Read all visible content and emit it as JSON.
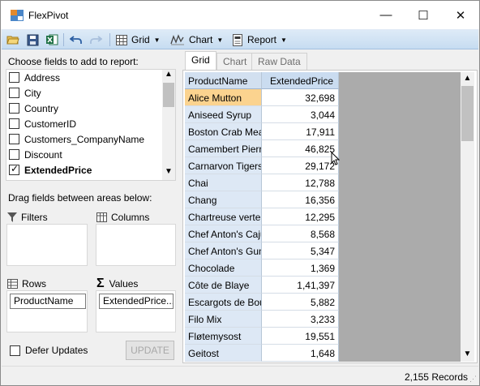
{
  "window": {
    "title": "FlexPivot",
    "minimize": "—",
    "maximize": "☐",
    "close": "✕"
  },
  "toolbar": {
    "grid_label": "Grid",
    "chart_label": "Chart",
    "report_label": "Report",
    "accent": "#c6dcf1"
  },
  "fields": {
    "caption": "Choose fields to add to report:",
    "items": [
      {
        "label": "Address",
        "checked": false
      },
      {
        "label": "City",
        "checked": false
      },
      {
        "label": "Country",
        "checked": false
      },
      {
        "label": "CustomerID",
        "checked": false
      },
      {
        "label": "Customers_CompanyName",
        "checked": false
      },
      {
        "label": "Discount",
        "checked": false
      },
      {
        "label": "ExtendedPrice",
        "checked": true
      }
    ]
  },
  "areas": {
    "caption": "Drag fields between areas below:",
    "filters": "Filters",
    "columns": "Columns",
    "rows": "Rows",
    "values": "Values",
    "rows_field": "ProductName",
    "values_field": "ExtendedPrice..."
  },
  "defer": {
    "label": "Defer Updates",
    "checked": false
  },
  "update_button": "UPDATE",
  "tabs": [
    {
      "label": "Grid",
      "active": true
    },
    {
      "label": "Chart",
      "active": false
    },
    {
      "label": "Raw Data",
      "active": false
    }
  ],
  "grid": {
    "headers": [
      "ProductName",
      "ExtendedPrice"
    ],
    "rows": [
      [
        "Alice Mutton",
        "32,698"
      ],
      [
        "Aniseed Syrup",
        "3,044"
      ],
      [
        "Boston Crab Meat",
        "17,911"
      ],
      [
        "Camembert Pierrot",
        "46,825"
      ],
      [
        "Carnarvon Tigers",
        "29,172"
      ],
      [
        "Chai",
        "12,788"
      ],
      [
        "Chang",
        "16,356"
      ],
      [
        "Chartreuse verte",
        "12,295"
      ],
      [
        "Chef Anton's Cajun",
        "8,568"
      ],
      [
        "Chef Anton's Gumb",
        "5,347"
      ],
      [
        "Chocolade",
        "1,369"
      ],
      [
        "Côte de Blaye",
        "1,41,397"
      ],
      [
        "Escargots de Bourg",
        "5,882"
      ],
      [
        "Filo Mix",
        "3,233"
      ],
      [
        "Fløtemysost",
        "19,551"
      ],
      [
        "Geitost",
        "1,648"
      ]
    ],
    "selected_row": 0
  },
  "status": {
    "records": "2,155 Records"
  }
}
